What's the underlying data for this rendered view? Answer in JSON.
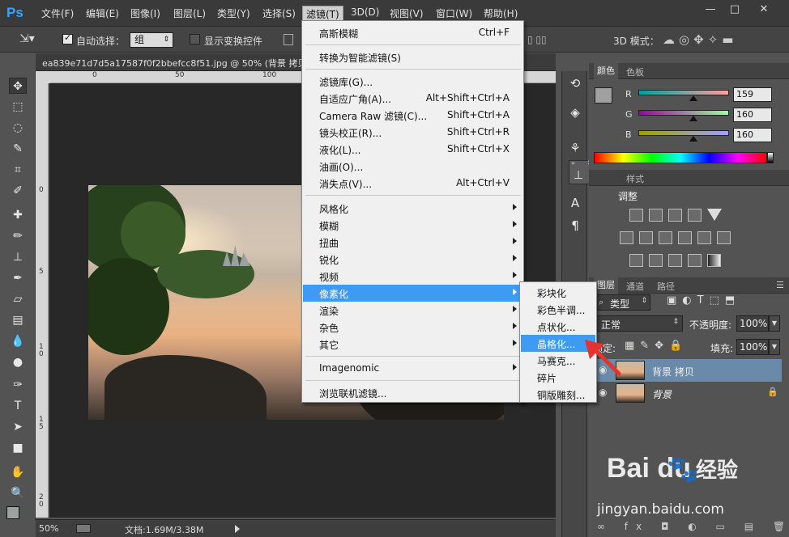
{
  "app": {
    "logo": "Ps",
    "menu": [
      "文件(F)",
      "编辑(E)",
      "图像(I)",
      "图层(L)",
      "类型(Y)",
      "选择(S)",
      "滤镜(T)",
      "3D(D)",
      "视图(V)",
      "窗口(W)",
      "帮助(H)"
    ],
    "active_menu_index": 6,
    "window_buttons": [
      "—",
      "□",
      "✕"
    ]
  },
  "options_bar": {
    "auto_select_label": "自动选择：",
    "auto_select_value": "组",
    "show_transform_label": "显示变换控件",
    "mode_3d_label": "3D 模式："
  },
  "document": {
    "tab_title": "ea839e71d7d5a17587f0f2bbefcc8f51.jpg @ 50% (背景 拷贝",
    "ruler_top_marks": [
      "0",
      "50",
      "100"
    ],
    "ruler_left_marks": [
      "0",
      "5",
      "1\n0",
      "1\n5",
      "2\n0"
    ]
  },
  "status_bar": {
    "zoom": "50%",
    "doc_info": "文档:1.69M/3.38M"
  },
  "filter_menu": {
    "items": [
      {
        "label": "高斯模糊",
        "shortcut": "Ctrl+F"
      },
      {
        "label": "转换为智能滤镜(S)",
        "shortcut": ""
      },
      {
        "label": "滤镜库(G)...",
        "shortcut": ""
      },
      {
        "label": "自适应广角(A)...",
        "shortcut": "Alt+Shift+Ctrl+A"
      },
      {
        "label": "Camera Raw 滤镜(C)...",
        "shortcut": "Shift+Ctrl+A"
      },
      {
        "label": "镜头校正(R)...",
        "shortcut": "Shift+Ctrl+R"
      },
      {
        "label": "液化(L)...",
        "shortcut": "Shift+Ctrl+X"
      },
      {
        "label": "油画(O)...",
        "shortcut": ""
      },
      {
        "label": "消失点(V)...",
        "shortcut": "Alt+Ctrl+V"
      },
      {
        "label": "风格化",
        "shortcut": ""
      },
      {
        "label": "模糊",
        "shortcut": ""
      },
      {
        "label": "扭曲",
        "shortcut": ""
      },
      {
        "label": "锐化",
        "shortcut": ""
      },
      {
        "label": "视频",
        "shortcut": ""
      },
      {
        "label": "像素化",
        "shortcut": ""
      },
      {
        "label": "渲染",
        "shortcut": ""
      },
      {
        "label": "杂色",
        "shortcut": ""
      },
      {
        "label": "其它",
        "shortcut": ""
      },
      {
        "label": "Imagenomic",
        "shortcut": ""
      },
      {
        "label": "浏览联机滤镜...",
        "shortcut": ""
      }
    ],
    "highlighted_index": 14
  },
  "pixelate_submenu": {
    "items": [
      "彩块化",
      "彩色半调...",
      "点状化...",
      "晶格化...",
      "马赛克...",
      "碎片",
      "铜版雕刻..."
    ],
    "highlighted_index": 3
  },
  "color_panel": {
    "tabs": [
      "颜色",
      "色板"
    ],
    "channels": [
      {
        "name": "R",
        "value": "159"
      },
      {
        "name": "G",
        "value": "160"
      },
      {
        "name": "B",
        "value": "160"
      }
    ]
  },
  "adjust_panel": {
    "tabs": [
      "样式"
    ],
    "title": "调整"
  },
  "layers_panel": {
    "tabs": [
      "图层",
      "通道",
      "路径"
    ],
    "kind_filter": "类型",
    "blend_mode": "正常",
    "opacity_label": "不透明度:",
    "opacity_value": "100%",
    "lock_label": "锁定:",
    "fill_label": "填充:",
    "fill_value": "100%",
    "layers": [
      {
        "name": "背景 拷贝",
        "selected": true
      },
      {
        "name": "背景",
        "selected": false
      }
    ]
  },
  "watermark": {
    "brand": "Bai  du",
    "brand_cn": "经验",
    "url": "jingyan.baidu.com"
  },
  "colors": {
    "menu_highlight": "#3d9bf4",
    "arrow_red": "#e8322f",
    "ps_blue": "#31a8ff"
  }
}
